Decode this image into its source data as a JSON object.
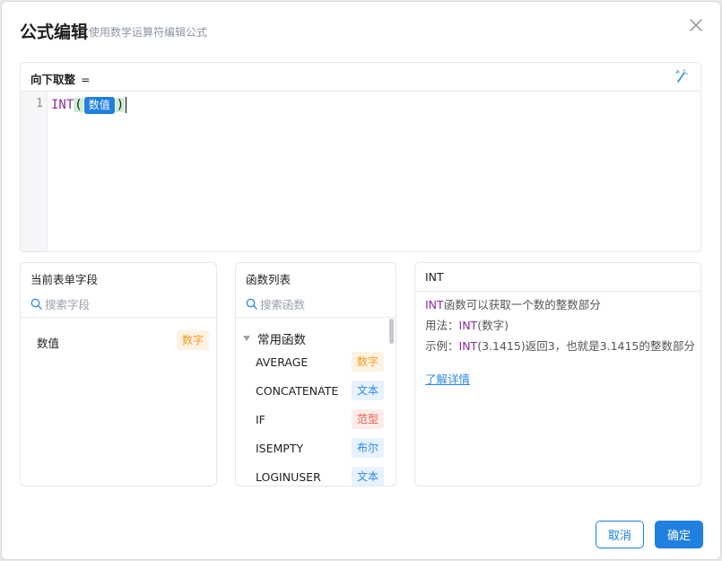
{
  "dialog": {
    "title": "公式编辑",
    "subtitle": "使用数学运算符编辑公式"
  },
  "editor": {
    "target_field": "向下取整",
    "equals": "=",
    "line_number": "1",
    "function_name": "INT",
    "open_paren": "(",
    "field_chip": "数值",
    "close_paren": ")"
  },
  "fields_panel": {
    "title": "当前表单字段",
    "search_placeholder": "搜索字段",
    "items": [
      {
        "name": "数值",
        "type": "数字"
      }
    ]
  },
  "functions_panel": {
    "title": "函数列表",
    "search_placeholder": "搜索函数",
    "group": "常用函数",
    "items": [
      {
        "name": "AVERAGE",
        "type": "数字"
      },
      {
        "name": "CONCATENATE",
        "type": "文本"
      },
      {
        "name": "IF",
        "type": "范型"
      },
      {
        "name": "ISEMPTY",
        "type": "布尔"
      },
      {
        "name": "LOGINUSER",
        "type": "文本"
      }
    ]
  },
  "detail_panel": {
    "title": "INT",
    "desc_fn": "INT",
    "desc_rest": "函数可以获取一个数的整数部分",
    "usage_label": "用法：",
    "usage_fn": "INT",
    "usage_rest": "(数字)",
    "example_label": "示例：",
    "example_fn": "INT",
    "example_rest": "(3.1415)返回3，也就是3.1415的整数部分",
    "learn_more": "了解详情"
  },
  "footer": {
    "cancel_label": "取消",
    "ok_label": "确定"
  },
  "colors": {
    "primary": "#1f80e0",
    "function_purple": "#8a2ba0",
    "tag_number": "#f59a23",
    "tag_text": "#2b8ae6",
    "tag_generic": "#e85a4f"
  }
}
